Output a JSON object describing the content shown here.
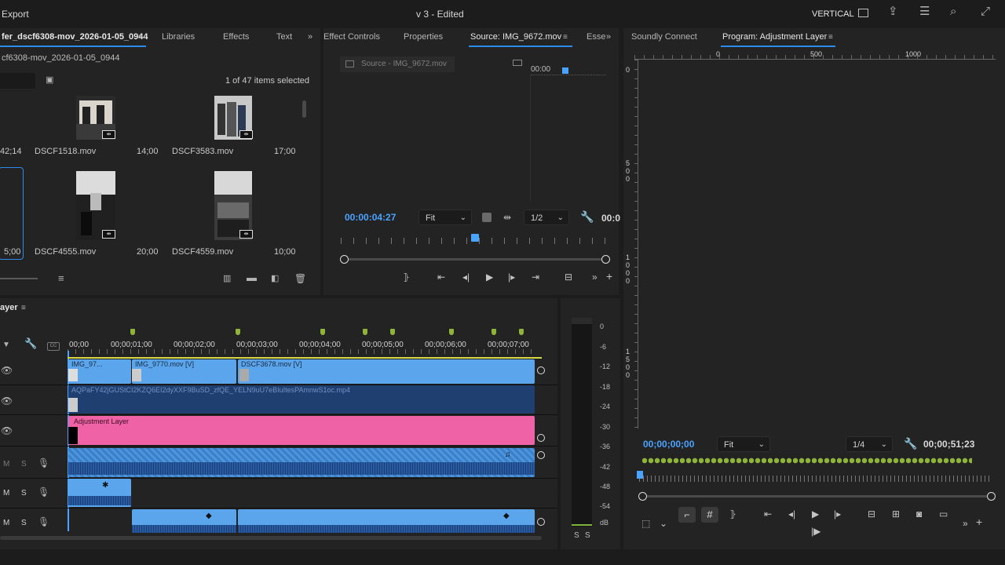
{
  "app": {
    "export_label": "Export",
    "doc_title": "v 3 - Edited",
    "workspace": "VERTICAL"
  },
  "project": {
    "tabs": [
      "fer_dscf6308-mov_2026-01-05_0944",
      "Libraries",
      "Effects",
      "Text"
    ],
    "bin_path": "cf6308-mov_2026-01-05_0944",
    "items_status": "1 of 47 items selected",
    "items": [
      {
        "name": "",
        "duration": "42;14"
      },
      {
        "name": "DSCF1518.mov",
        "duration": "14;00"
      },
      {
        "name": "DSCF3583.mov",
        "duration": "17;00"
      },
      {
        "name": "",
        "duration": "5;00"
      },
      {
        "name": "DSCF4555.mov",
        "duration": "20;00"
      },
      {
        "name": "DSCF4559.mov",
        "duration": "10;00"
      }
    ]
  },
  "source": {
    "tabs": [
      "Effect Controls",
      "Properties",
      "Source: IMG_9672.mov",
      "Esse"
    ],
    "faded_label": "Source - IMG_9672.mov",
    "mini_timecode": "00:00",
    "timecode": "00:00:04:27",
    "fit": "Fit",
    "res": "1/2",
    "duration_partial": "00:0"
  },
  "program": {
    "tabs": [
      "Soundly Connect",
      "Program: Adjustment Layer"
    ],
    "ruler_h": [
      "0",
      "500",
      "1000"
    ],
    "ruler_v": [
      [
        "0"
      ],
      [
        "5",
        "0",
        "0"
      ],
      [
        "1",
        "0",
        "0",
        "0"
      ],
      [
        "1",
        "5",
        "0",
        "0"
      ]
    ],
    "timecode": "00;00;00;00",
    "fit": "Fit",
    "res": "1/4",
    "duration": "00;00;51;23"
  },
  "timeline": {
    "title": "ayer",
    "ruler": [
      "00;00",
      "00;00;01;00",
      "00;00;02;00",
      "00;00;03;00",
      "00;00;04;00",
      "00;00;05;00",
      "00;00;06;00",
      "00;00;07;00"
    ],
    "clips": {
      "v3a": "IMG_97...",
      "v3b": "IMG_9770.mov [V]",
      "v3c": "DSCF3678.mov [V]",
      "v2": "AQPaFY42jGUStCI2KZQ6EI2dyXXF9BuSD_zfQE_YELN9uU7eBIuItesPAmnwS1oc.mp4",
      "v1": "Adjustment Layer"
    },
    "audio_labels": {
      "m": "M",
      "s": "S"
    }
  },
  "meter": {
    "levels": [
      "0",
      "-6",
      "-12",
      "-18",
      "-24",
      "-30",
      "-36",
      "-42",
      "-48",
      "-54",
      "dB"
    ],
    "solo": [
      "S",
      "S"
    ]
  },
  "colors": {
    "accent": "#2d8ceb",
    "clip_blue": "#5aa5ec",
    "adj_pink": "#f062a6",
    "marker": "#8fb43a",
    "tc_blue": "#4aa3ff"
  }
}
